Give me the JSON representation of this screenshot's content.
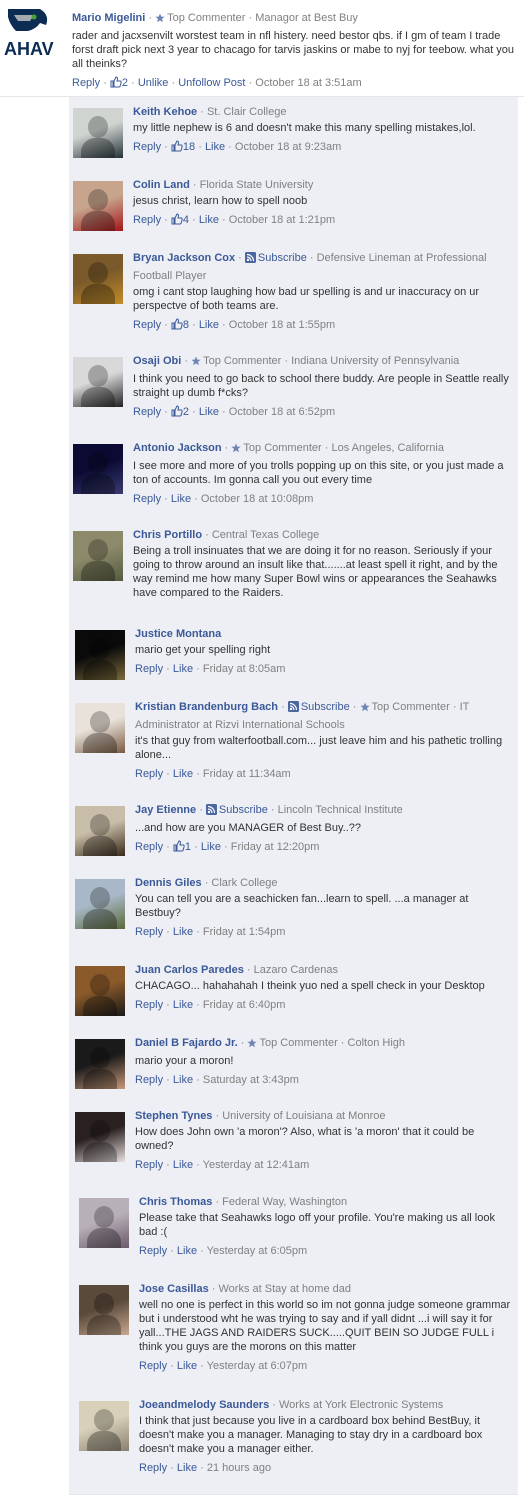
{
  "colors": {
    "link": "#3b5998",
    "meta": "#808080",
    "bg": "#edeff4",
    "seahawks_navy": "#0d2c54",
    "seahawks_green": "#4da32f"
  },
  "main": {
    "name": "Mario Migelini",
    "star_icon": "star-icon",
    "badge": "Top Commenter",
    "meta": "Managor at Best Buy",
    "logo_text": "AHAV",
    "text": "rader and jacxsenvilt worstest team in nfl histery. need bestor qbs. if I gm of team I trade forst draft pick next 3 year to chacago for tarvis jaskins or mabe to nyj for teebow. what you all theinks?",
    "reply": "Reply",
    "likes": "2",
    "unlike": "Unlike",
    "unfollow": "Unfollow Post",
    "time": "October 18 at 3:51am"
  },
  "labels": {
    "reply": "Reply",
    "like": "Like",
    "subscribe": "Subscribe",
    "top_commenter": "Top Commenter"
  },
  "comments": [
    {
      "name": "Keith Kehoe",
      "meta": "St. Clair College",
      "text": "my little nephew is 6 and doesn't make this many spelling mistakes,lol.",
      "likes": "18",
      "time": "October 18 at 9:23am",
      "colors": [
        "#cfd4d0",
        "#263238"
      ]
    },
    {
      "name": "Colin Land",
      "meta": "Florida State University",
      "text": "jesus christ, learn how to spell noob",
      "likes": "4",
      "time": "October 18 at 1:21pm",
      "colors": [
        "#c7a58d",
        "#a4161a"
      ]
    },
    {
      "name": "Bryan Jackson Cox",
      "subscribe": "Subscribe",
      "meta": "Defensive Lineman at Professional Football Player",
      "text": "omg i cant stop laughing how bad ur spelling is and ur inaccuracy on ur perspectve of both teams are.",
      "likes": "8",
      "time": "October 18 at 1:55pm",
      "colors": [
        "#7a5a2a",
        "#c28c28"
      ]
    },
    {
      "name": "Osaji Obi",
      "badge": "Top Commenter",
      "meta": "Indiana University of Pennsylvania",
      "text": "I think you need to go back to school there buddy. Are people in Seattle really straight up dumb f*cks?",
      "likes": "2",
      "time": "October 18 at 6:52pm",
      "colors": [
        "#d9d9d9",
        "#222222"
      ]
    },
    {
      "name": "Antonio Jackson",
      "badge": "Top Commenter",
      "meta": "Los Angeles, California",
      "text": "I see more and more of you trolls popping up on this site, or you just made a ton of accounts. Im gonna call you out every time",
      "time": "October 18 at 10:08pm",
      "colors": [
        "#0a0a33",
        "#3a3a70"
      ]
    },
    {
      "name": "Chris Portillo",
      "meta": "Central Texas College",
      "text": "Being a troll insinuates that we are doing it for no reason. Seriously if your going to throw around an insult like that.......at least spell it right, and by the way remind me how many Super Bowl wins or appearances the Seahawks have compared to the Raiders.",
      "time": "",
      "colors": [
        "#8c8a6a",
        "#555a40"
      ]
    },
    {
      "name": "Justice Montana",
      "text": "mario get your spelling right",
      "time": "Friday at 8:05am",
      "colors": [
        "#0a0a0a",
        "#7a6a3a"
      ]
    },
    {
      "name": "Kristian Brandenburg Bach",
      "subscribe": "Subscribe",
      "badge": "Top Commenter",
      "meta": "IT Administrator at Rizvi International Schools",
      "text": "it's that guy from walterfootball.com... just leave him and his pathetic trolling alone...",
      "time": "Friday at 11:34am",
      "colors": [
        "#e8e2da",
        "#7a5a40"
      ]
    },
    {
      "name": "Jay Etienne",
      "subscribe": "Subscribe",
      "meta": "Lincoln Technical Institute",
      "text": "...and how are you MANAGER of Best Buy..??",
      "likes": "1",
      "time": "Friday at 12:20pm",
      "colors": [
        "#c8bda8",
        "#3a2a1a"
      ]
    },
    {
      "name": "Dennis Giles",
      "meta": "Clark College",
      "text": "You can tell you are a seachicken fan...learn to spell. ...a manager at Bestbuy?",
      "time": "Friday at 1:54pm",
      "colors": [
        "#a8b8c8",
        "#5a6a3a"
      ]
    },
    {
      "name": "Juan Carlos Paredes",
      "meta": "Lazaro Cardenas",
      "text": "CHACAGO... hahahahah I theink yuo ned a spell check in your Desktop",
      "time": "Friday at 6:40pm",
      "colors": [
        "#8a5a2a",
        "#1a1a1a"
      ]
    },
    {
      "name": "Daniel B Fajardo Jr.",
      "badge": "Top Commenter",
      "meta": "Colton High",
      "text": "mario your a moron!",
      "time": "Saturday at 3:43pm",
      "colors": [
        "#1a1a1a",
        "#c89a7a"
      ]
    },
    {
      "name": "Stephen Tynes",
      "meta": "University of Louisiana at Monroe",
      "text": "How does John own 'a moron'? Also, what is 'a moron' that it could be owned?",
      "time": "Yesterday at 12:41am",
      "colors": [
        "#2a2020",
        "#e8e0e0"
      ]
    },
    {
      "name": "Chris Thomas",
      "meta": "Federal Way, Washington",
      "text": "Please take that Seahawks logo off your profile. You're making us all look bad :(",
      "time": "Yesterday at 6:05pm",
      "colors": [
        "#b8b0b8",
        "#6a5a6a"
      ]
    },
    {
      "name": "Jose Casillas",
      "meta": "Works at Stay at home dad",
      "text": "well no one is perfect in this world so im not gonna judge someone grammar but i understood wht he was trying to say and if yall didnt ...i will say it for yall...THE JAGS AND RAIDERS SUCK.....QUIT BEIN SO JUDGE FULL i think you guys are the morons on this matter",
      "time": "Yesterday at 6:07pm",
      "colors": [
        "#5a4a3a",
        "#c8a890"
      ]
    },
    {
      "name": "Joeandmelody Saunders",
      "meta": "Works at York Electronic Systems",
      "text": "I think that just because you live in a cardboard box behind BestBuy, it doesn't make you a manager. Managing to stay dry in a cardboard box doesn't make you a manager either.",
      "time": "21 hours ago",
      "colors": [
        "#d8d0b8",
        "#8a8070"
      ]
    }
  ]
}
